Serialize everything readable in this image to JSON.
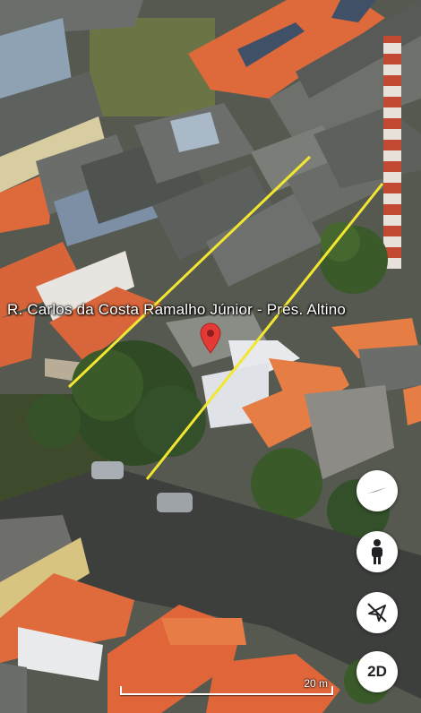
{
  "map": {
    "street_label": "R. Carlos da Costa Ramalho Júnior - Pres. Altino",
    "pin_icon": "location-pin-icon",
    "pin_color": "#e53935",
    "measure_line_color": "#f2e631",
    "roof_tile_color": "#e0663a"
  },
  "controls": {
    "compass_icon": "compass-icon",
    "street_view_icon": "pegman-icon",
    "tilt_icon": "tilt-toggle-icon",
    "view_mode_label": "2D"
  },
  "scale": {
    "label": "20 m"
  }
}
